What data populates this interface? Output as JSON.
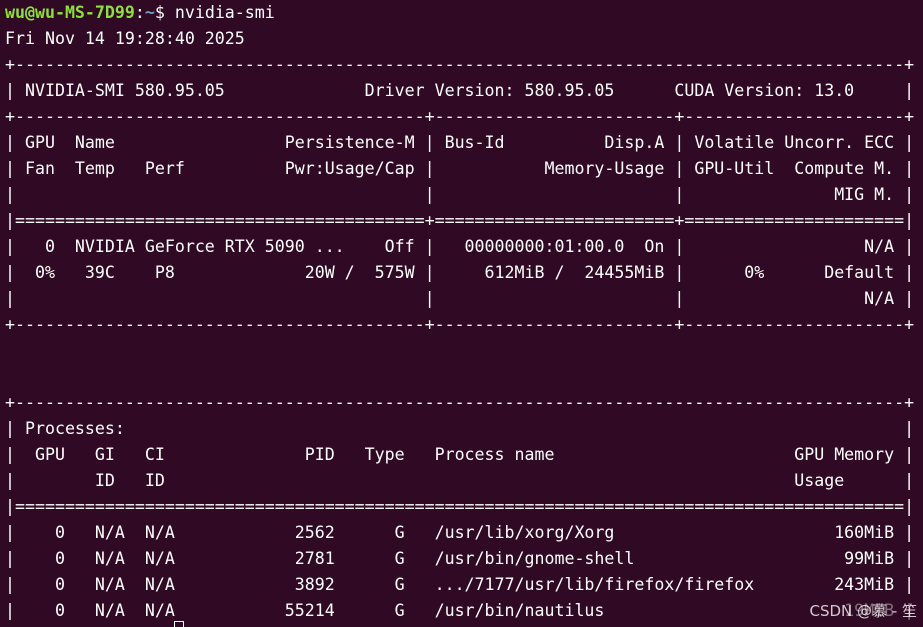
{
  "terminal": {
    "prompt": {
      "user_host": "wu@wu-MS-7D99",
      "separator": ":",
      "path": "~",
      "symbol": "$ ",
      "command": "nvidia-smi"
    },
    "lines": [
      "Fri Nov 14 19:28:40 2025",
      "+-----------------------------------------------------------------------------------------+",
      "| NVIDIA-SMI 580.95.05              Driver Version: 580.95.05      CUDA Version: 13.0     |",
      "+-----------------------------------------+------------------------+----------------------+",
      "| GPU  Name                 Persistence-M | Bus-Id          Disp.A | Volatile Uncorr. ECC |",
      "| Fan  Temp   Perf          Pwr:Usage/Cap |           Memory-Usage | GPU-Util  Compute M. |",
      "|                                         |                        |               MIG M. |",
      "|=========================================+========================+======================|",
      "|   0  NVIDIA GeForce RTX 5090 ...    Off |   00000000:01:00.0  On |                  N/A |",
      "|  0%   39C    P8             20W /  575W |     612MiB /  24455MiB |      0%      Default |",
      "|                                         |                        |                  N/A |",
      "+-----------------------------------------+------------------------+----------------------+",
      "",
      "",
      "+-----------------------------------------------------------------------------------------+",
      "| Processes:                                                                              |",
      "|  GPU   GI   CI              PID   Type   Process name                        GPU Memory |",
      "|        ID   ID                                                               Usage      |",
      "|=========================================================================================|",
      "|    0   N/A  N/A            2562      G   /usr/lib/xorg/Xorg                      160MiB |",
      "|    0   N/A  N/A            2781      G   /usr/bin/gnome-shell                     99MiB |",
      "|    0   N/A  N/A            3892      G   .../7177/usr/lib/firefox/firefox        243MiB |",
      "|    0   N/A  N/A           55214      G   /usr/bin/nautilus                        19MiB |",
      "+-----------------------------------------------------------------------------------------+"
    ]
  },
  "watermark": "CSDN @慕 - 笙",
  "colors": {
    "background": "#300a24",
    "foreground": "#ffffff",
    "prompt_user": "#8ae234",
    "prompt_path": "#729fcf"
  }
}
